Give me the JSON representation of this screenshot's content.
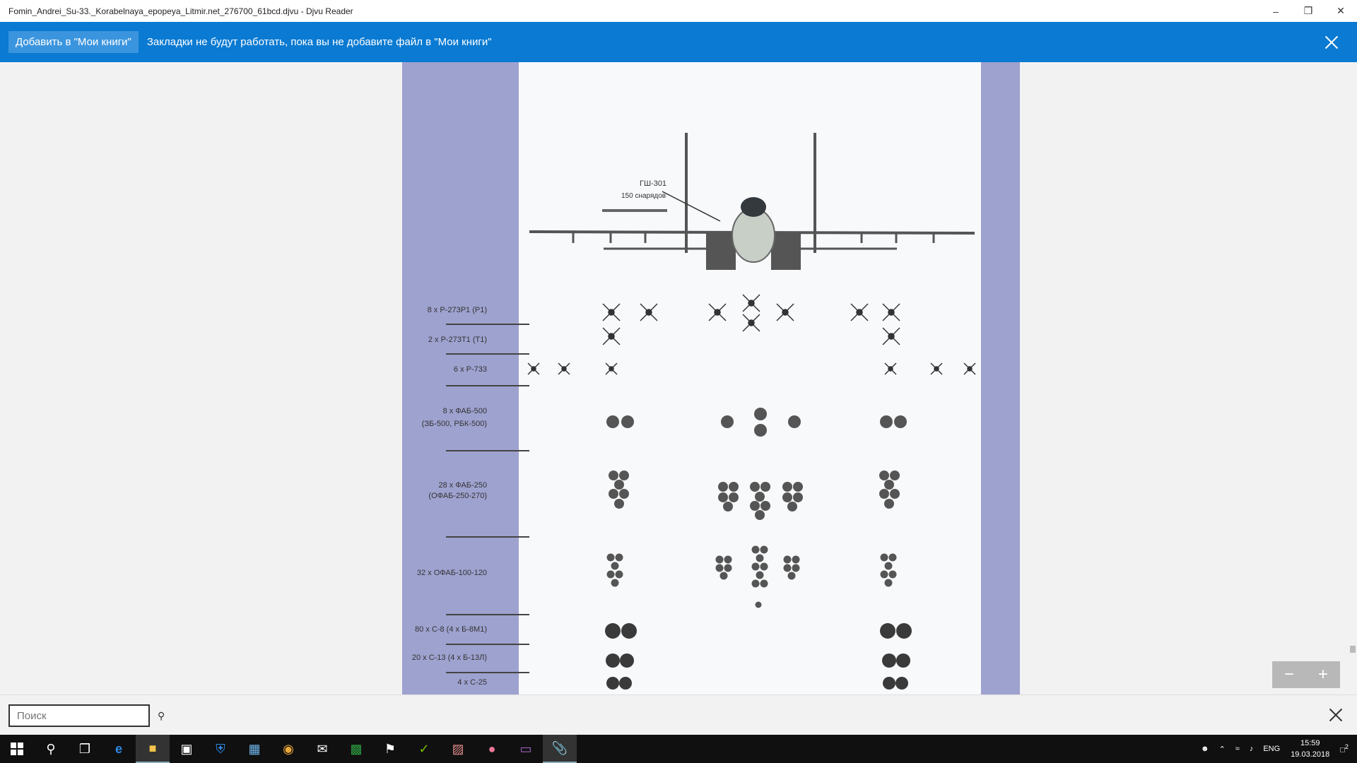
{
  "window": {
    "title": "Fomin_Andrei_Su-33._Korabelnaya_epopeya_Litmir.net_276700_61bcd.djvu - Djvu Reader",
    "minimize": "–",
    "restore": "❐",
    "close": "✕"
  },
  "infobar": {
    "add_button": "Добавить в \"Мои книги\"",
    "message": "Закладки не будут работать, пока вы не добавите файл в \"Мои книги\""
  },
  "figure": {
    "gun_label": "ГШ-301",
    "gun_sub": "150 снарядов",
    "rows": [
      {
        "label": "8 x P-273P1 (P1)"
      },
      {
        "label": "2 x P-273T1 (T1)"
      },
      {
        "label": "6 x P-733"
      },
      {
        "label": "8 x ФАБ-500",
        "label2": "(ЗБ-500, РБК-500)"
      },
      {
        "label": "28 x ФАБ-250",
        "label2": "(ОФАБ-250-270)"
      },
      {
        "label": "32 x ОФАБ-100-120"
      },
      {
        "label": "80 x C-8 (4 x Б-8М1)"
      },
      {
        "label": "20 x C-13 (4 x Б-13Л)"
      },
      {
        "label": "4 x C-25"
      }
    ]
  },
  "zoom": {
    "minus": "−",
    "plus": "+"
  },
  "search": {
    "placeholder": "Поиск"
  },
  "taskbar": {
    "apps": [
      "windows-start",
      "search",
      "task-view",
      "edge",
      "file-explorer",
      "store",
      "defender",
      "calendar",
      "chrome",
      "mail",
      "excel",
      "pin",
      "nvidia",
      "books",
      "octopus",
      "folder-sync",
      "djvu-reader"
    ],
    "language": "ENG",
    "time": "15:59",
    "date": "19.03.2018",
    "notifications": "2"
  }
}
